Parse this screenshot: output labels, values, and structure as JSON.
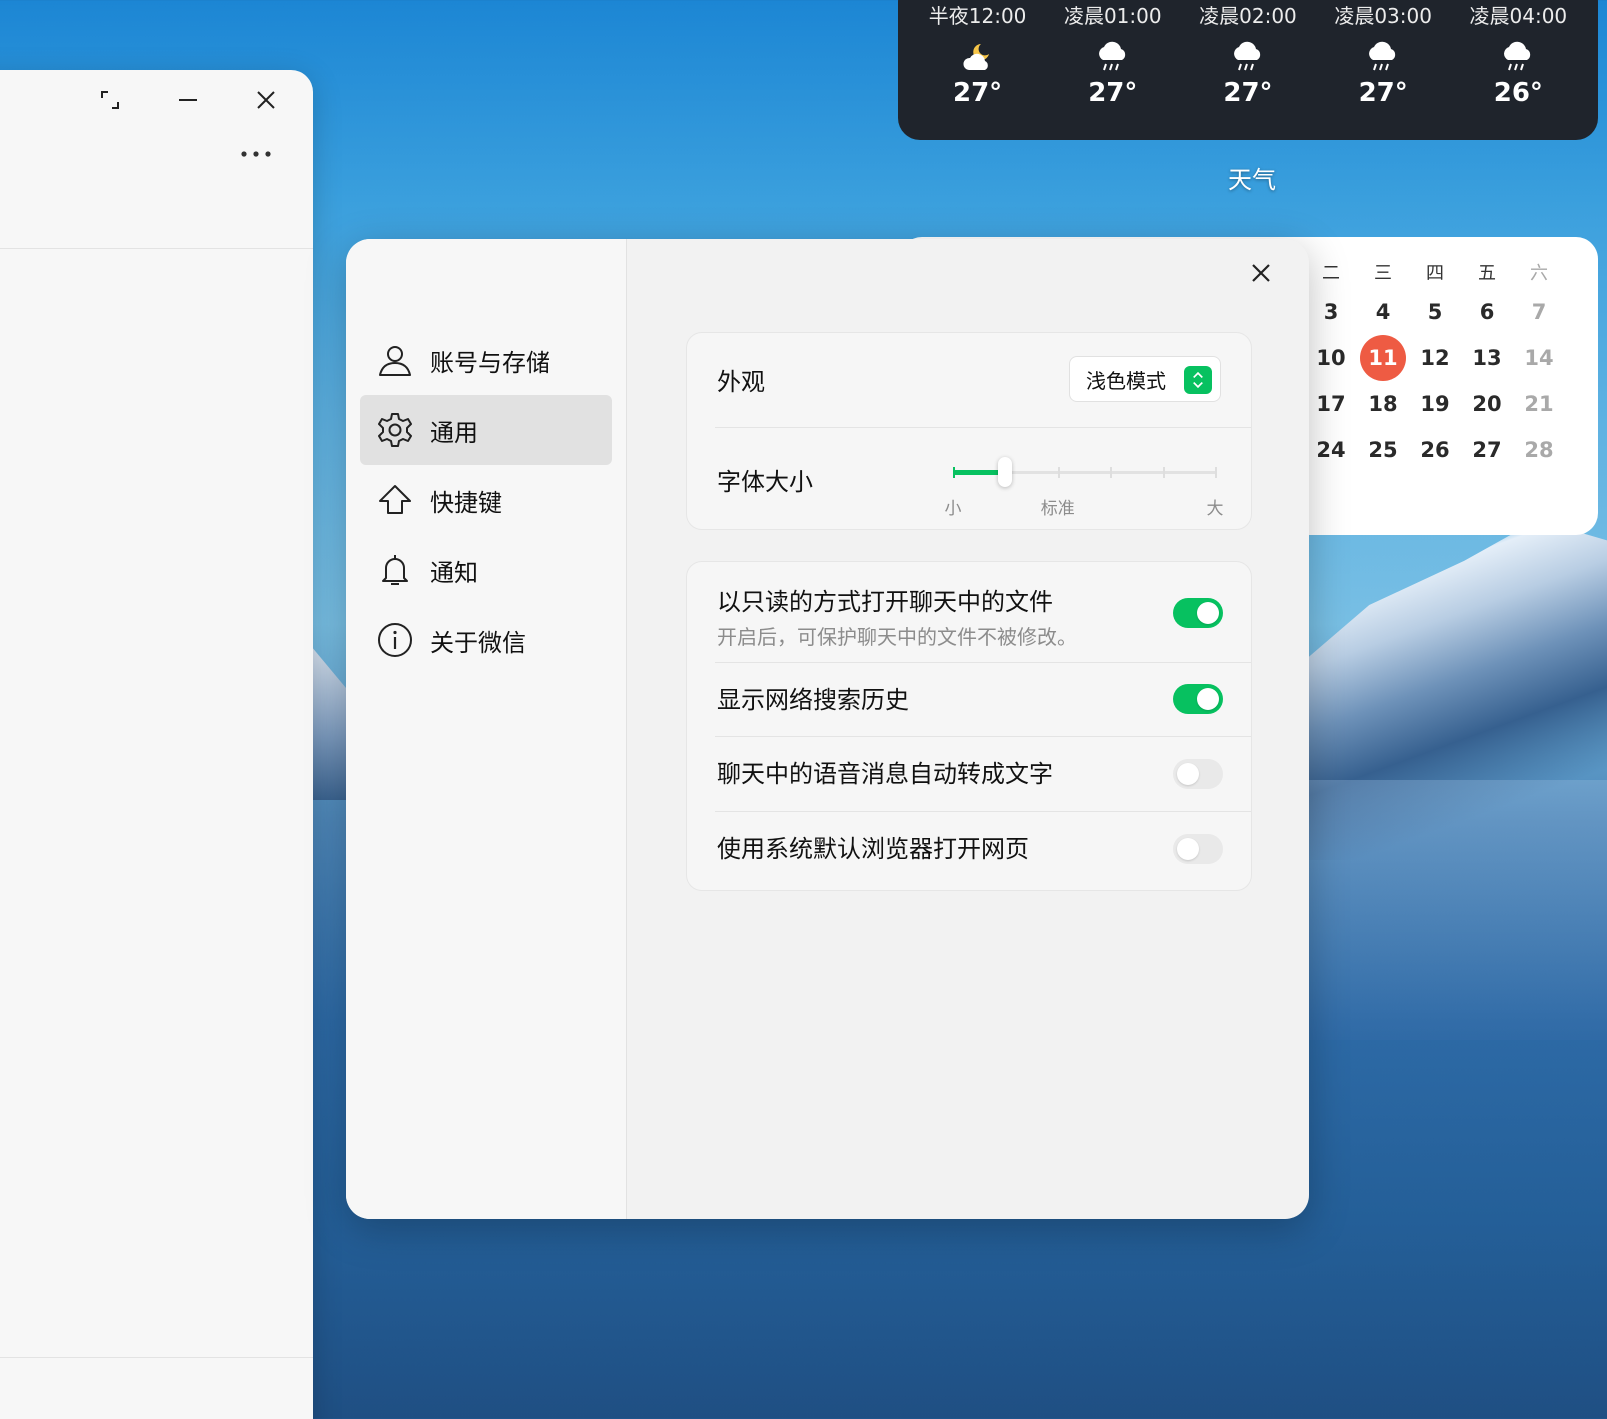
{
  "weather": {
    "label": "天气",
    "hours": [
      {
        "time": "半夜12:00",
        "icon": "moon-cloud-icon",
        "temp": "27°"
      },
      {
        "time": "凌晨01:00",
        "icon": "rain-icon",
        "temp": "27°"
      },
      {
        "time": "凌晨02:00",
        "icon": "rain-icon",
        "temp": "27°"
      },
      {
        "time": "凌晨03:00",
        "icon": "rain-icon",
        "temp": "27°"
      },
      {
        "time": "凌晨04:00",
        "icon": "rain-icon",
        "temp": "26°"
      }
    ]
  },
  "calendar": {
    "weekdays": [
      "二",
      "三",
      "四",
      "五",
      "六"
    ],
    "rows": [
      [
        "3",
        "4",
        "5",
        "6",
        "7"
      ],
      [
        "10",
        "11",
        "12",
        "13",
        "14"
      ],
      [
        "17",
        "18",
        "19",
        "20",
        "21"
      ],
      [
        "24",
        "25",
        "26",
        "27",
        "28"
      ]
    ],
    "today": "11",
    "today_color": "#ee5b43"
  },
  "settings": {
    "nav": [
      {
        "label": "账号与存储",
        "icon": "user-icon"
      },
      {
        "label": "通用",
        "icon": "gear-icon",
        "active": true
      },
      {
        "label": "快捷键",
        "icon": "shortcut-arrow-icon"
      },
      {
        "label": "通知",
        "icon": "bell-icon"
      },
      {
        "label": "关于微信",
        "icon": "info-icon"
      }
    ],
    "appearance": {
      "label": "外观",
      "value": "浅色模式"
    },
    "font_size": {
      "label": "字体大小",
      "tick_labels": {
        "min": "小",
        "standard": "标准",
        "max": "大"
      },
      "steps": 6,
      "selected_step": 1
    },
    "toggles": [
      {
        "title": "以只读的方式打开聊天中的文件",
        "subtitle": "开启后，可保护聊天中的文件不被修改。",
        "on": true
      },
      {
        "title": "显示网络搜索历史",
        "on": true
      },
      {
        "title": "聊天中的语音消息自动转成文字",
        "on": false
      },
      {
        "title": "使用系统默认浏览器打开网页",
        "on": false
      }
    ],
    "accent_color": "#07c160"
  }
}
